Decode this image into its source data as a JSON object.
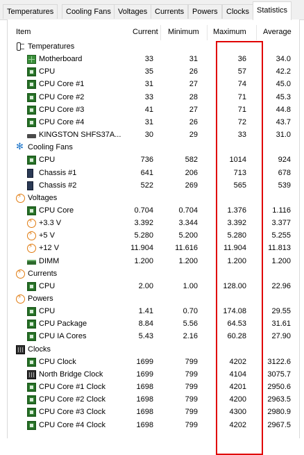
{
  "tabs": [
    {
      "label": "Temperatures"
    },
    {
      "label": "Cooling Fans"
    },
    {
      "label": "Voltages"
    },
    {
      "label": "Currents"
    },
    {
      "label": "Powers"
    },
    {
      "label": "Clocks"
    },
    {
      "label": "Statistics",
      "active": true
    }
  ],
  "columns": {
    "item": "Item",
    "current": "Current",
    "minimum": "Minimum",
    "maximum": "Maximum",
    "average": "Average"
  },
  "categories": [
    {
      "name": "Temperatures",
      "icon": "thermometer-icon",
      "rows": [
        {
          "label": "Motherboard",
          "icon": "motherboard-icon",
          "current": "33",
          "minimum": "31",
          "maximum": "36",
          "average": "34.0"
        },
        {
          "label": "CPU",
          "icon": "chip-icon",
          "current": "35",
          "minimum": "26",
          "maximum": "57",
          "average": "42.2"
        },
        {
          "label": "CPU Core #1",
          "icon": "chip-icon",
          "current": "31",
          "minimum": "27",
          "maximum": "74",
          "average": "45.0"
        },
        {
          "label": "CPU Core #2",
          "icon": "chip-icon",
          "current": "33",
          "minimum": "28",
          "maximum": "71",
          "average": "45.3"
        },
        {
          "label": "CPU Core #3",
          "icon": "chip-icon",
          "current": "41",
          "minimum": "27",
          "maximum": "71",
          "average": "44.8"
        },
        {
          "label": "CPU Core #4",
          "icon": "chip-icon",
          "current": "31",
          "minimum": "26",
          "maximum": "72",
          "average": "43.7"
        },
        {
          "label": "KINGSTON SHFS37A...",
          "icon": "disk-icon",
          "current": "30",
          "minimum": "29",
          "maximum": "33",
          "average": "31.0"
        }
      ]
    },
    {
      "name": "Cooling Fans",
      "icon": "fan-icon",
      "rows": [
        {
          "label": "CPU",
          "icon": "chip-icon",
          "current": "736",
          "minimum": "582",
          "maximum": "1014",
          "average": "924"
        },
        {
          "label": "Chassis #1",
          "icon": "chassis-icon",
          "current": "641",
          "minimum": "206",
          "maximum": "713",
          "average": "678"
        },
        {
          "label": "Chassis #2",
          "icon": "chassis-icon",
          "current": "522",
          "minimum": "269",
          "maximum": "565",
          "average": "539"
        }
      ]
    },
    {
      "name": "Voltages",
      "icon": "lightning-icon",
      "rows": [
        {
          "label": "CPU Core",
          "icon": "chip-icon",
          "current": "0.704",
          "minimum": "0.704",
          "maximum": "1.376",
          "average": "1.116"
        },
        {
          "label": "+3.3 V",
          "icon": "lightning-icon",
          "current": "3.392",
          "minimum": "3.344",
          "maximum": "3.392",
          "average": "3.377"
        },
        {
          "label": "+5 V",
          "icon": "lightning-icon",
          "current": "5.280",
          "minimum": "5.200",
          "maximum": "5.280",
          "average": "5.255"
        },
        {
          "label": "+12 V",
          "icon": "lightning-icon",
          "current": "11.904",
          "minimum": "11.616",
          "maximum": "11.904",
          "average": "11.813"
        },
        {
          "label": "DIMM",
          "icon": "dimm-icon",
          "current": "1.200",
          "minimum": "1.200",
          "maximum": "1.200",
          "average": "1.200"
        }
      ]
    },
    {
      "name": "Currents",
      "icon": "lightning-icon",
      "rows": [
        {
          "label": "CPU",
          "icon": "chip-icon",
          "current": "2.00",
          "minimum": "1.00",
          "maximum": "128.00",
          "average": "22.96"
        }
      ]
    },
    {
      "name": "Powers",
      "icon": "lightning-icon",
      "rows": [
        {
          "label": "CPU",
          "icon": "chip-icon",
          "current": "1.41",
          "minimum": "0.70",
          "maximum": "174.08",
          "average": "29.55"
        },
        {
          "label": "CPU Package",
          "icon": "chip-icon",
          "current": "8.84",
          "minimum": "5.56",
          "maximum": "64.53",
          "average": "31.61"
        },
        {
          "label": "CPU IA Cores",
          "icon": "chip-icon",
          "current": "5.43",
          "minimum": "2.16",
          "maximum": "60.28",
          "average": "27.90"
        }
      ]
    },
    {
      "name": "Clocks",
      "icon": "clock-chip-icon",
      "rows": [
        {
          "label": "CPU Clock",
          "icon": "chip-icon",
          "current": "1699",
          "minimum": "799",
          "maximum": "4202",
          "average": "3122.6"
        },
        {
          "label": "North Bridge Clock",
          "icon": "clock-chip-icon",
          "current": "1699",
          "minimum": "799",
          "maximum": "4104",
          "average": "3075.7"
        },
        {
          "label": "CPU Core #1 Clock",
          "icon": "chip-icon",
          "current": "1698",
          "minimum": "799",
          "maximum": "4201",
          "average": "2950.6"
        },
        {
          "label": "CPU Core #2 Clock",
          "icon": "chip-icon",
          "current": "1698",
          "minimum": "799",
          "maximum": "4200",
          "average": "2963.5"
        },
        {
          "label": "CPU Core #3 Clock",
          "icon": "chip-icon",
          "current": "1698",
          "minimum": "799",
          "maximum": "4300",
          "average": "2980.9"
        },
        {
          "label": "CPU Core #4 Clock",
          "icon": "chip-icon",
          "current": "1698",
          "minimum": "799",
          "maximum": "4202",
          "average": "2967.5"
        }
      ]
    }
  ],
  "colors": {
    "highlight_box": "#e00000",
    "chip": "#2d7a2d",
    "fan": "#1a73c9",
    "voltage": "#e07b10"
  }
}
